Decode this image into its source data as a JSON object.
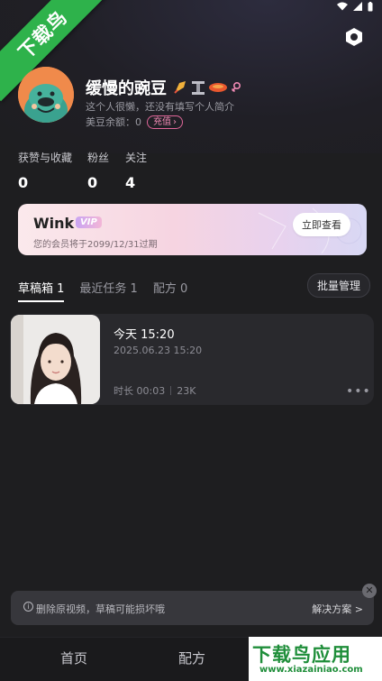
{
  "watermark_ribbon": "下载鸟",
  "profile": {
    "username": "缓慢的豌豆",
    "bio": "这个人很懒，还没有填写个人简介",
    "balance_label": "美豆余额：",
    "balance_value": "0",
    "recharge_label": "充值"
  },
  "stats": [
    {
      "label": "获赞与收藏",
      "value": "0"
    },
    {
      "label": "粉丝",
      "value": "0"
    },
    {
      "label": "关注",
      "value": "4"
    }
  ],
  "vip": {
    "brand": "Wink",
    "tag": "VIP",
    "subtitle": "您的会员将于2099/12/31过期",
    "button": "立即查看"
  },
  "tabs": [
    {
      "label": "草稿箱 1",
      "active": true
    },
    {
      "label": "最近任务 1",
      "active": false
    },
    {
      "label": "配方 0",
      "active": false
    }
  ],
  "batch_manage": "批量管理",
  "draft": {
    "title": "今天 15:20",
    "date": "2025.06.23 15:20",
    "duration": "时长 00:03",
    "size": "23K",
    "more": "•••"
  },
  "toast": {
    "message": "删除原视频，草稿可能损坏哦",
    "link": "解决方案 >",
    "close": "✕"
  },
  "bottom_nav": [
    {
      "label": "首页"
    },
    {
      "label": "配方"
    }
  ],
  "site_watermark": {
    "title": "下载鸟应用",
    "url": "www.xiazainiao.com"
  },
  "colors": {
    "background": "#1e1e20",
    "ribbon": "#2eb24b",
    "accent_pink": "#e0679a"
  }
}
